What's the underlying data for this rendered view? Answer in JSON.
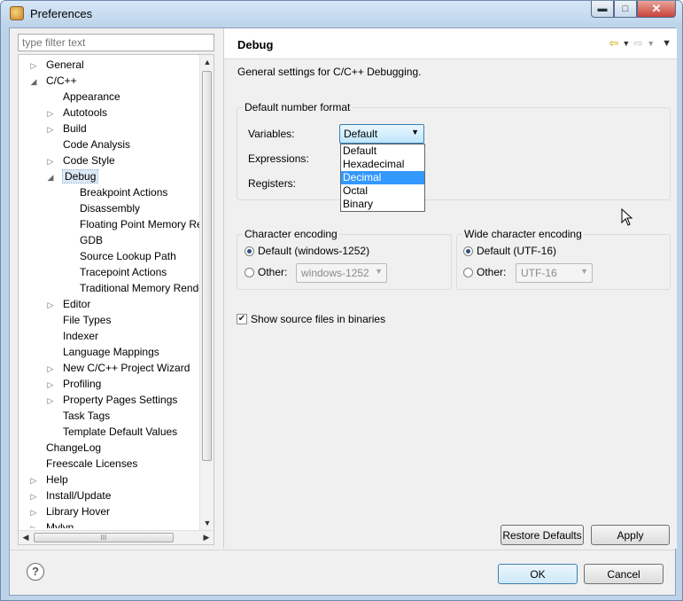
{
  "window": {
    "title": "Preferences",
    "minimize": "▬",
    "maximize": "□",
    "close": "✕"
  },
  "filter": {
    "placeholder": "type filter text"
  },
  "tree": {
    "nodes": [
      {
        "label": "General",
        "twisty": "▷"
      },
      {
        "label": "C/C++",
        "twisty": "◢"
      },
      {
        "label": "Appearance",
        "twisty": ""
      },
      {
        "label": "Autotools",
        "twisty": "▷"
      },
      {
        "label": "Build",
        "twisty": "▷"
      },
      {
        "label": "Code Analysis",
        "twisty": ""
      },
      {
        "label": "Code Style",
        "twisty": "▷"
      },
      {
        "label": "Debug",
        "twisty": "◢"
      },
      {
        "label": "Breakpoint Actions",
        "twisty": ""
      },
      {
        "label": "Disassembly",
        "twisty": ""
      },
      {
        "label": "Floating Point Memory Rer",
        "twisty": ""
      },
      {
        "label": "GDB",
        "twisty": ""
      },
      {
        "label": "Source Lookup Path",
        "twisty": ""
      },
      {
        "label": "Tracepoint Actions",
        "twisty": ""
      },
      {
        "label": "Traditional Memory Render",
        "twisty": ""
      },
      {
        "label": "Editor",
        "twisty": "▷"
      },
      {
        "label": "File Types",
        "twisty": ""
      },
      {
        "label": "Indexer",
        "twisty": ""
      },
      {
        "label": "Language Mappings",
        "twisty": ""
      },
      {
        "label": "New C/C++ Project Wizard",
        "twisty": "▷"
      },
      {
        "label": "Profiling",
        "twisty": "▷"
      },
      {
        "label": "Property Pages Settings",
        "twisty": "▷"
      },
      {
        "label": "Task Tags",
        "twisty": ""
      },
      {
        "label": "Template Default Values",
        "twisty": ""
      },
      {
        "label": "ChangeLog",
        "twisty": ""
      },
      {
        "label": "Freescale Licenses",
        "twisty": ""
      },
      {
        "label": "Help",
        "twisty": "▷"
      },
      {
        "label": "Install/Update",
        "twisty": "▷"
      },
      {
        "label": "Library Hover",
        "twisty": "▷"
      },
      {
        "label": "Mylyn",
        "twisty": "▷"
      }
    ],
    "hscroll_grip": "III"
  },
  "page": {
    "title": "Debug",
    "description": "General settings for C/C++ Debugging.",
    "number_format": {
      "title": "Default number format",
      "variables_label": "Variables:",
      "expressions_label": "Expressions:",
      "registers_label": "Registers:",
      "variables_value": "Default",
      "options": [
        "Default",
        "Hexadecimal",
        "Decimal",
        "Octal",
        "Binary"
      ],
      "highlighted": "Decimal"
    },
    "char_encoding": {
      "title": "Character encoding",
      "default_label": "Default (windows-1252)",
      "other_label": "Other:",
      "other_value": "windows-1252"
    },
    "wide_encoding": {
      "title": "Wide character encoding",
      "default_label": "Default (UTF-16)",
      "other_label": "Other:",
      "other_value": "UTF-16"
    },
    "show_source_label": "Show source files in binaries",
    "restore_defaults": "Restore Defaults",
    "apply": "Apply"
  },
  "footer": {
    "help": "?",
    "ok": "OK",
    "cancel": "Cancel"
  }
}
